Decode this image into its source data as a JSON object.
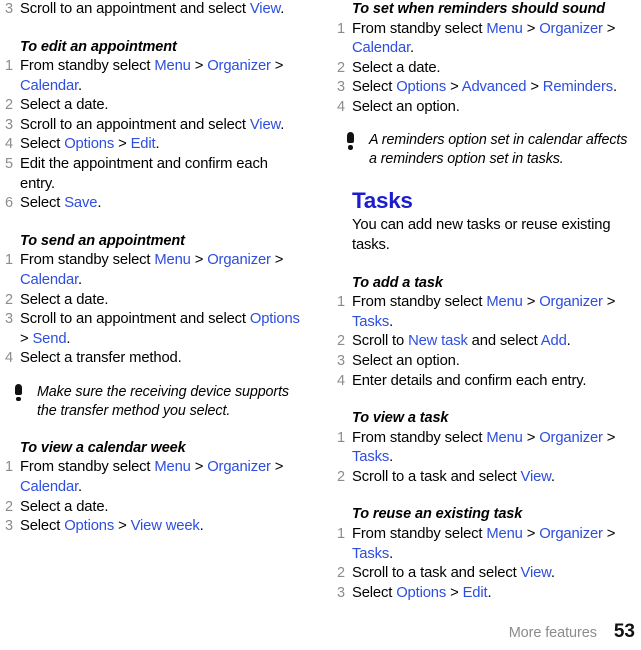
{
  "document": {
    "footer_label": "More features",
    "page_number": "53",
    "link_color": "#2d4ede",
    "heading_color": "#1c1ccc",
    "number_color": "#8c8c8c"
  },
  "left_column": {
    "blocks": [
      {
        "type": "steps",
        "start_number": 3,
        "items": [
          {
            "num": "3",
            "parts": [
              {
                "t": "Scroll to an appointment and select ",
                "s": "plain"
              },
              {
                "t": "View",
                "s": "kw"
              },
              {
                "t": ".",
                "s": "plain"
              }
            ]
          }
        ]
      },
      {
        "type": "heading",
        "text": "To edit an appointment",
        "spacing": "large"
      },
      {
        "type": "steps",
        "items": [
          {
            "num": "1",
            "parts": [
              {
                "t": "From standby select ",
                "s": "plain"
              },
              {
                "t": "Menu",
                "s": "kw"
              },
              {
                "t": " > ",
                "s": "plain"
              },
              {
                "t": "Organizer",
                "s": "kw"
              },
              {
                "t": " > ",
                "s": "plain"
              },
              {
                "t": "Calendar",
                "s": "kw"
              },
              {
                "t": ".",
                "s": "plain"
              }
            ]
          },
          {
            "num": "2",
            "parts": [
              {
                "t": "Select a date.",
                "s": "plain"
              }
            ]
          },
          {
            "num": "3",
            "parts": [
              {
                "t": "Scroll to an appointment and select ",
                "s": "plain"
              },
              {
                "t": "View",
                "s": "kw"
              },
              {
                "t": ".",
                "s": "plain"
              }
            ]
          },
          {
            "num": "4",
            "parts": [
              {
                "t": "Select ",
                "s": "plain"
              },
              {
                "t": "Options",
                "s": "kw"
              },
              {
                "t": " > ",
                "s": "plain"
              },
              {
                "t": "Edit",
                "s": "kw"
              },
              {
                "t": ".",
                "s": "plain"
              }
            ]
          },
          {
            "num": "5",
            "parts": [
              {
                "t": "Edit the appointment and confirm each entry.",
                "s": "plain"
              }
            ]
          },
          {
            "num": "6",
            "parts": [
              {
                "t": "Select ",
                "s": "plain"
              },
              {
                "t": "Save",
                "s": "kw"
              },
              {
                "t": ".",
                "s": "plain"
              }
            ]
          }
        ]
      },
      {
        "type": "heading",
        "text": "To send an appointment",
        "spacing": "large"
      },
      {
        "type": "steps",
        "items": [
          {
            "num": "1",
            "parts": [
              {
                "t": "From standby select ",
                "s": "plain"
              },
              {
                "t": "Menu",
                "s": "kw"
              },
              {
                "t": " > ",
                "s": "plain"
              },
              {
                "t": "Organizer",
                "s": "kw"
              },
              {
                "t": " > ",
                "s": "plain"
              },
              {
                "t": "Calendar",
                "s": "kw"
              },
              {
                "t": ".",
                "s": "plain"
              }
            ]
          },
          {
            "num": "2",
            "parts": [
              {
                "t": "Select a date.",
                "s": "plain"
              }
            ]
          },
          {
            "num": "3",
            "parts": [
              {
                "t": "Scroll to an appointment and select ",
                "s": "plain"
              },
              {
                "t": "Options",
                "s": "kw"
              },
              {
                "t": " > ",
                "s": "plain"
              },
              {
                "t": "Send",
                "s": "kw"
              },
              {
                "t": ".",
                "s": "plain"
              }
            ]
          },
          {
            "num": "4",
            "parts": [
              {
                "t": "Select a transfer method.",
                "s": "plain"
              }
            ]
          }
        ]
      },
      {
        "type": "note",
        "text": "Make sure the receiving device supports the transfer method you select."
      },
      {
        "type": "heading",
        "text": "To view a calendar week",
        "spacing": "large"
      },
      {
        "type": "steps",
        "items": [
          {
            "num": "1",
            "parts": [
              {
                "t": "From standby select ",
                "s": "plain"
              },
              {
                "t": "Menu",
                "s": "kw"
              },
              {
                "t": " > ",
                "s": "plain"
              },
              {
                "t": "Organizer",
                "s": "kw"
              },
              {
                "t": " > ",
                "s": "plain"
              },
              {
                "t": "Calendar",
                "s": "kw"
              },
              {
                "t": ".",
                "s": "plain"
              }
            ]
          },
          {
            "num": "2",
            "parts": [
              {
                "t": "Select a date.",
                "s": "plain"
              }
            ]
          },
          {
            "num": "3",
            "parts": [
              {
                "t": "Select ",
                "s": "plain"
              },
              {
                "t": "Options",
                "s": "kw"
              },
              {
                "t": " > ",
                "s": "plain"
              },
              {
                "t": "View week",
                "s": "kw"
              },
              {
                "t": ".",
                "s": "plain"
              }
            ]
          }
        ]
      }
    ]
  },
  "right_column": {
    "blocks": [
      {
        "type": "heading",
        "text": "To set when reminders should sound",
        "spacing": "none"
      },
      {
        "type": "steps",
        "items": [
          {
            "num": "1",
            "parts": [
              {
                "t": "From standby select ",
                "s": "plain"
              },
              {
                "t": "Menu",
                "s": "kw"
              },
              {
                "t": " > ",
                "s": "plain"
              },
              {
                "t": "Organizer",
                "s": "kw"
              },
              {
                "t": " > ",
                "s": "plain"
              },
              {
                "t": "Calendar",
                "s": "kw"
              },
              {
                "t": ".",
                "s": "plain"
              }
            ]
          },
          {
            "num": "2",
            "parts": [
              {
                "t": "Select a date.",
                "s": "plain"
              }
            ]
          },
          {
            "num": "3",
            "parts": [
              {
                "t": "Select ",
                "s": "plain"
              },
              {
                "t": "Options",
                "s": "kw"
              },
              {
                "t": " > ",
                "s": "plain"
              },
              {
                "t": "Advanced",
                "s": "kw"
              },
              {
                "t": " > ",
                "s": "plain"
              },
              {
                "t": "Reminders",
                "s": "kw"
              },
              {
                "t": ".",
                "s": "plain"
              }
            ]
          },
          {
            "num": "4",
            "parts": [
              {
                "t": "Select an option.",
                "s": "plain"
              }
            ]
          }
        ]
      },
      {
        "type": "note",
        "text": "A reminders option set in calendar affects a reminders option set in tasks."
      },
      {
        "type": "section",
        "title": "Tasks",
        "intro": "You can add new tasks or reuse existing tasks."
      },
      {
        "type": "heading",
        "text": "To add a task",
        "spacing": "large"
      },
      {
        "type": "steps",
        "items": [
          {
            "num": "1",
            "parts": [
              {
                "t": "From standby select ",
                "s": "plain"
              },
              {
                "t": "Menu",
                "s": "kw"
              },
              {
                "t": " > ",
                "s": "plain"
              },
              {
                "t": "Organizer",
                "s": "kw"
              },
              {
                "t": " > ",
                "s": "plain"
              },
              {
                "t": "Tasks",
                "s": "kw"
              },
              {
                "t": ".",
                "s": "plain"
              }
            ]
          },
          {
            "num": "2",
            "parts": [
              {
                "t": "Scroll to ",
                "s": "plain"
              },
              {
                "t": "New task",
                "s": "kw"
              },
              {
                "t": " and select ",
                "s": "plain"
              },
              {
                "t": "Add",
                "s": "kw"
              },
              {
                "t": ".",
                "s": "plain"
              }
            ]
          },
          {
            "num": "3",
            "parts": [
              {
                "t": "Select an option.",
                "s": "plain"
              }
            ]
          },
          {
            "num": "4",
            "parts": [
              {
                "t": "Enter details and confirm each entry.",
                "s": "plain"
              }
            ]
          }
        ]
      },
      {
        "type": "heading",
        "text": "To view a task",
        "spacing": "large"
      },
      {
        "type": "steps",
        "items": [
          {
            "num": "1",
            "parts": [
              {
                "t": "From standby select ",
                "s": "plain"
              },
              {
                "t": "Menu",
                "s": "kw"
              },
              {
                "t": " > ",
                "s": "plain"
              },
              {
                "t": "Organizer",
                "s": "kw"
              },
              {
                "t": " > ",
                "s": "plain"
              },
              {
                "t": "Tasks",
                "s": "kw"
              },
              {
                "t": ".",
                "s": "plain"
              }
            ]
          },
          {
            "num": "2",
            "parts": [
              {
                "t": "Scroll to a task and select ",
                "s": "plain"
              },
              {
                "t": "View",
                "s": "kw"
              },
              {
                "t": ".",
                "s": "plain"
              }
            ]
          }
        ]
      },
      {
        "type": "heading",
        "text": "To reuse an existing task",
        "spacing": "large"
      },
      {
        "type": "steps",
        "items": [
          {
            "num": "1",
            "parts": [
              {
                "t": "From standby select ",
                "s": "plain"
              },
              {
                "t": "Menu",
                "s": "kw"
              },
              {
                "t": " > ",
                "s": "plain"
              },
              {
                "t": "Organizer",
                "s": "kw"
              },
              {
                "t": " > ",
                "s": "plain"
              },
              {
                "t": "Tasks",
                "s": "kw"
              },
              {
                "t": ".",
                "s": "plain"
              }
            ]
          },
          {
            "num": "2",
            "parts": [
              {
                "t": "Scroll to a task and select ",
                "s": "plain"
              },
              {
                "t": "View",
                "s": "kw"
              },
              {
                "t": ".",
                "s": "plain"
              }
            ]
          },
          {
            "num": "3",
            "parts": [
              {
                "t": "Select ",
                "s": "plain"
              },
              {
                "t": "Options",
                "s": "kw"
              },
              {
                "t": " > ",
                "s": "plain"
              },
              {
                "t": "Edit",
                "s": "kw"
              },
              {
                "t": ".",
                "s": "plain"
              }
            ]
          }
        ]
      }
    ]
  }
}
